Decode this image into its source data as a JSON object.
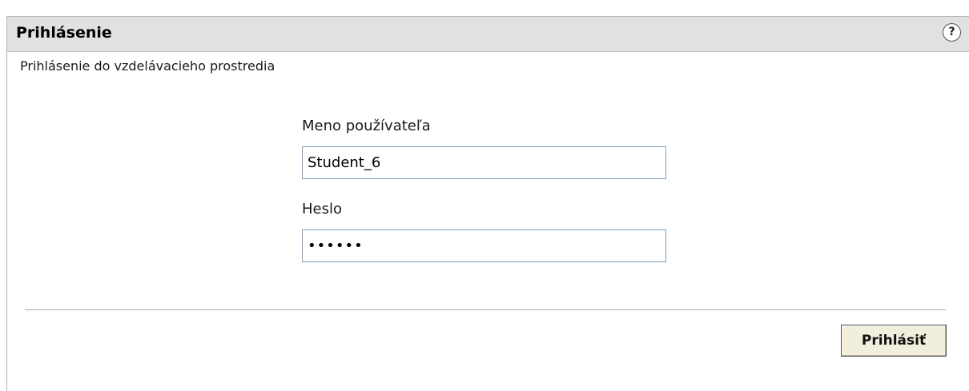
{
  "panel": {
    "title": "Prihlásenie",
    "help_icon_glyph": "?",
    "help_icon_name": "help-icon"
  },
  "form": {
    "intro": "Prihlásenie do vzdelávacieho prostredia",
    "username_label": "Meno používateľa",
    "username_value": "Student_6",
    "password_label": "Heslo",
    "password_value": "••••••",
    "submit_label": "Prihlásiť"
  },
  "colors": {
    "header_background": "#e1e1e1",
    "input_border": "#7f9db9",
    "button_background": "#f2eedc"
  }
}
